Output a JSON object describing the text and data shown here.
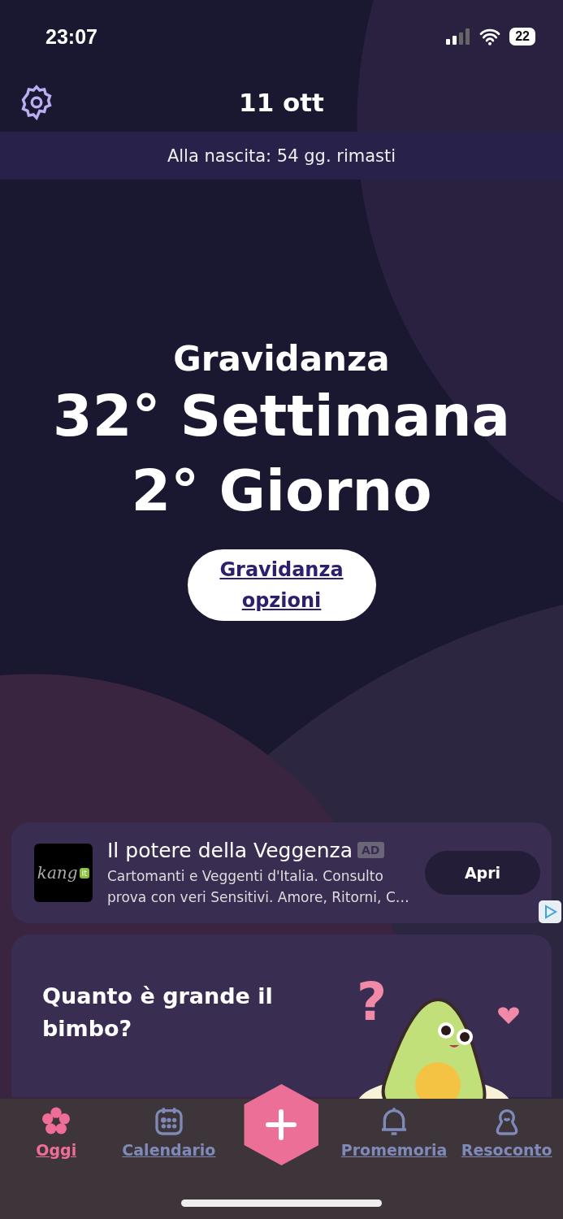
{
  "status_bar": {
    "time": "23:07",
    "battery": "22"
  },
  "header": {
    "title": "11 ott"
  },
  "banner": {
    "text": "Alla nascita: 54 gg. rimasti"
  },
  "hero": {
    "subtitle": "Gravidanza",
    "week": "32° Settimana",
    "day": "2° Giorno",
    "button": "Gravidanza opzioni"
  },
  "ad": {
    "logo_text": "kang",
    "logo_badge": "it",
    "title": "Il potere della Veggenza",
    "badge": "AD",
    "description": "Cartomanti e Veggenti d'Italia. Consulto prova con veri Sensitivi. Amore, Ritorni, C…",
    "button": "Apri"
  },
  "size_card": {
    "title": "Quanto è grande il bimbo?",
    "mark": "?"
  },
  "nav": [
    {
      "kind": "tab",
      "label": "Oggi",
      "selected": true
    },
    {
      "kind": "tab",
      "label": "Calendario",
      "selected": false
    },
    {
      "kind": "add"
    },
    {
      "kind": "tab",
      "label": "Promemoria",
      "selected": false
    },
    {
      "kind": "tab",
      "label": "Resoconto",
      "selected": false
    }
  ]
}
